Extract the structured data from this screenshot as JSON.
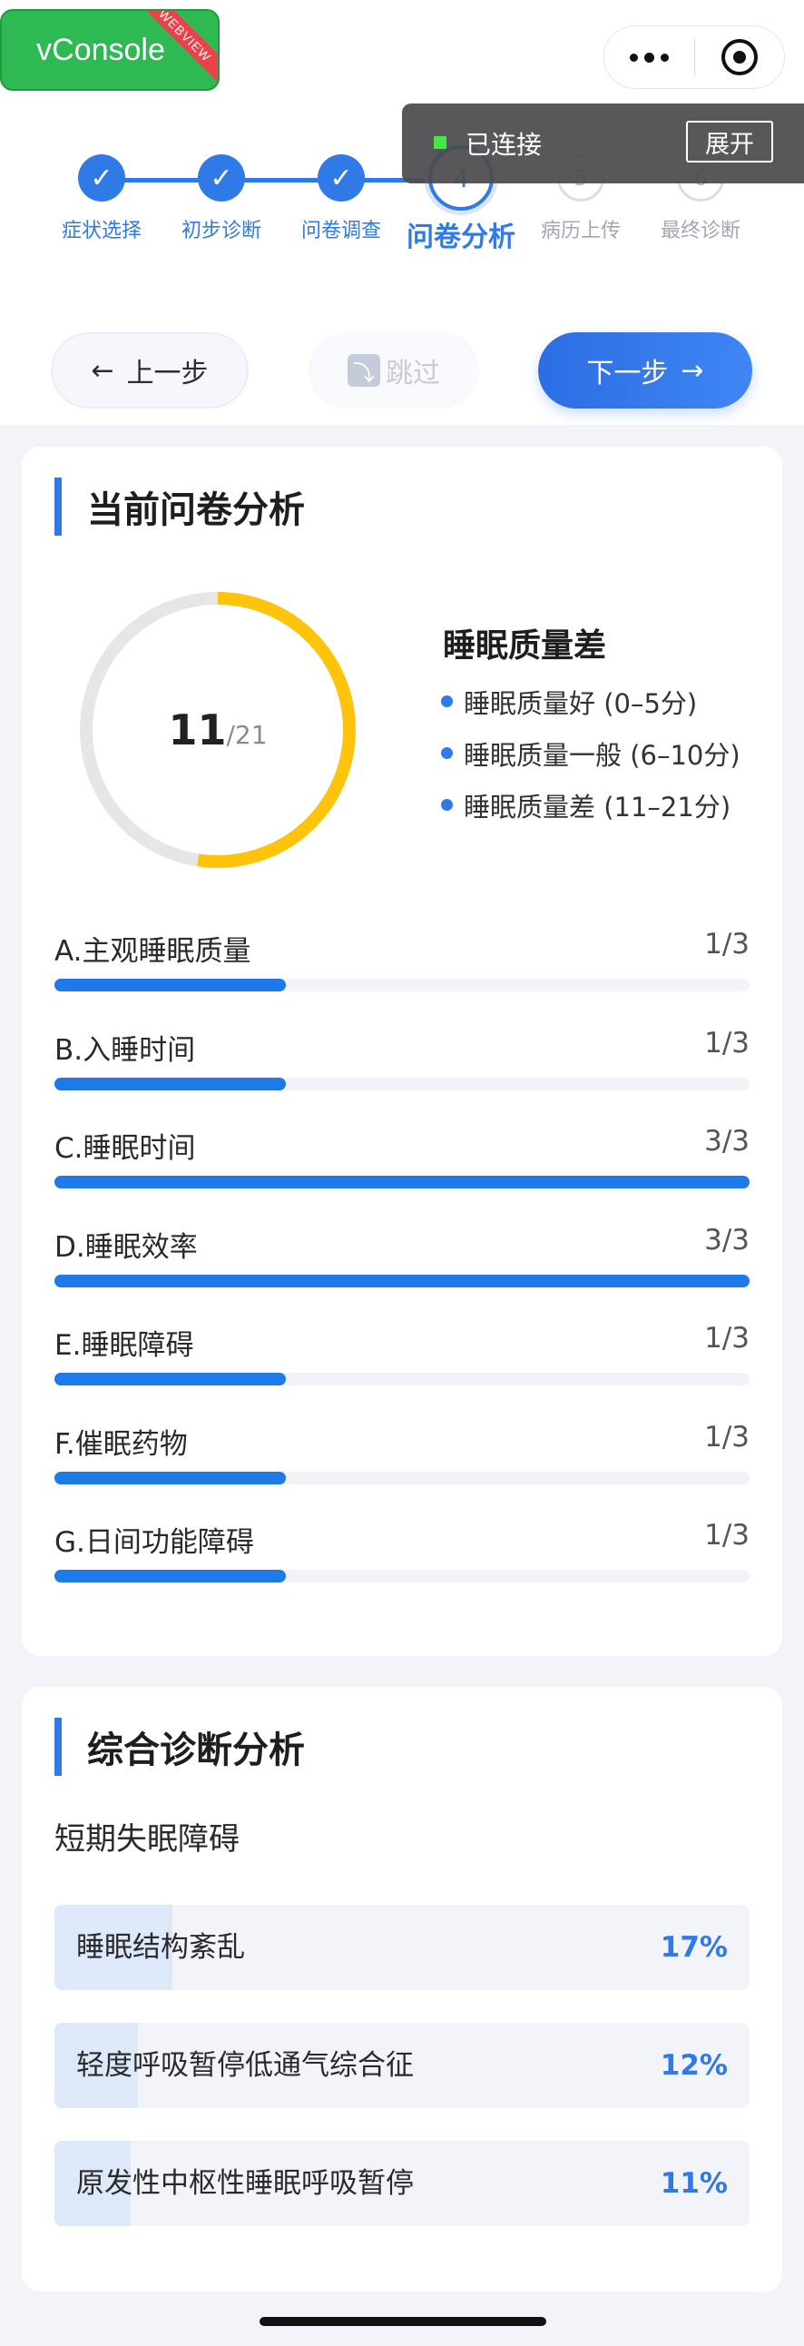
{
  "vconsole": {
    "label": "vConsole",
    "ribbon": "WEBVIEW"
  },
  "connection": {
    "status": "已连接",
    "expand": "展开"
  },
  "stepper": {
    "steps": [
      {
        "label": "症状选择",
        "state": "done",
        "mark": "✓"
      },
      {
        "label": "初步诊断",
        "state": "done",
        "mark": "✓"
      },
      {
        "label": "问卷调查",
        "state": "done",
        "mark": "✓"
      },
      {
        "label": "问卷分析",
        "state": "current",
        "mark": "4"
      },
      {
        "label": "病历上传",
        "state": "todo",
        "mark": "5"
      },
      {
        "label": "最终诊断",
        "state": "todo",
        "mark": "6"
      }
    ]
  },
  "actions": {
    "prev": {
      "arrow": "←",
      "label": "上一步"
    },
    "skip": {
      "icon": "⤵",
      "label": "跳过"
    },
    "next": {
      "arrow": "→",
      "label": "下一步"
    }
  },
  "analysis": {
    "title": "当前问卷分析",
    "score": "11",
    "total": "/21",
    "score_fraction": 0.5238,
    "level": "睡眠质量差",
    "legend": [
      "睡眠质量好 (0–5分)",
      "睡眠质量一般 (6–10分)",
      "睡眠质量差 (11–21分)"
    ],
    "factors": [
      {
        "name": "A.主观睡眠质量",
        "score": "1/3",
        "fraction": 0.3333
      },
      {
        "name": "B.入睡时间",
        "score": "1/3",
        "fraction": 0.3333
      },
      {
        "name": "C.睡眠时间",
        "score": "3/3",
        "fraction": 1.0
      },
      {
        "name": "D.睡眠效率",
        "score": "3/3",
        "fraction": 1.0
      },
      {
        "name": "E.睡眠障碍",
        "score": "1/3",
        "fraction": 0.3333
      },
      {
        "name": "F.催眠药物",
        "score": "1/3",
        "fraction": 0.3333
      },
      {
        "name": "G.日间功能障碍",
        "score": "1/3",
        "fraction": 0.3333
      }
    ]
  },
  "diagnosis": {
    "title": "综合诊断分析",
    "primary": "短期失眠障碍",
    "items": [
      {
        "name": "睡眠结构紊乱",
        "percent": "17%",
        "value": 0.17
      },
      {
        "name": "轻度呼吸暂停低通气综合征",
        "percent": "12%",
        "value": 0.12
      },
      {
        "name": "原发性中枢性睡眠呼吸暂停",
        "percent": "11%",
        "value": 0.11
      }
    ]
  },
  "colors": {
    "accent": "#2f7ae6",
    "donut_score": "#fec30b",
    "donut_track": "#e6e6e8",
    "bar": "#1f7ae9",
    "vconsole": "#2fb953"
  }
}
